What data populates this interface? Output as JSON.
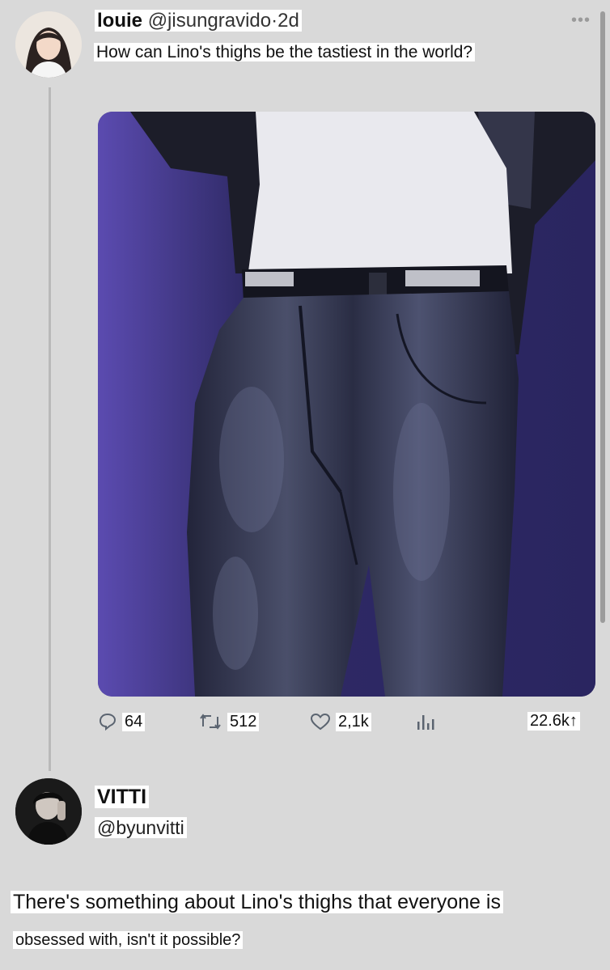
{
  "tweet": {
    "author_name": "louie",
    "author_handle": "@jisungravido",
    "time_sep": "·",
    "time": "2d",
    "more_label": "•••",
    "text": "How can Lino's thighs be the tastiest in the world?",
    "media_description": "Photo of a performer in a white t-shirt, black leather jacket, studded belt and black leather pants against a purple stage background",
    "stats": {
      "replies": "64",
      "retweets": "512",
      "likes": "2,1k",
      "views": "22.6k↑"
    }
  },
  "reply": {
    "author_name": "VITTI",
    "author_handle": "@byunvitti",
    "text_line1": "There's something about Lino's thighs that everyone is",
    "text_line2": "obsessed with, isn't it possible?"
  },
  "colors": {
    "background": "#d9d9d9",
    "thread_line": "#b9b9b9",
    "media_bg": "#3a3170",
    "icon": "#5b6470"
  },
  "icons": [
    "reply-icon",
    "retweet-icon",
    "like-icon",
    "views-icon",
    "more-icon"
  ]
}
